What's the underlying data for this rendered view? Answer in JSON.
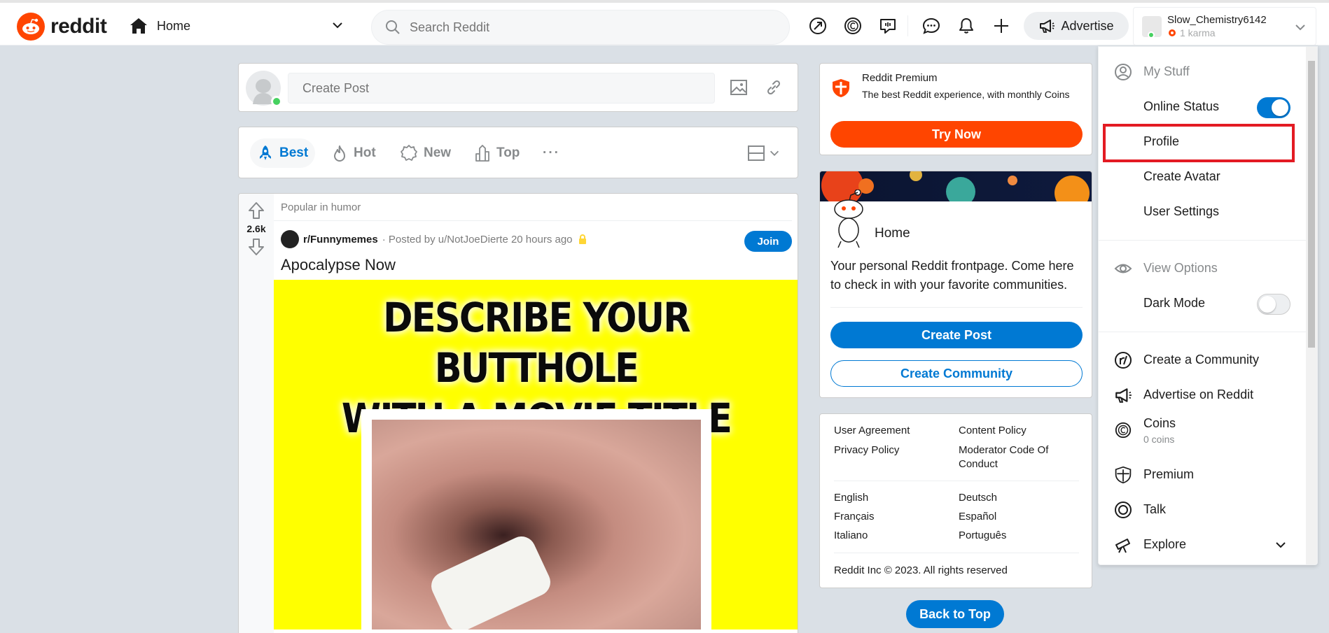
{
  "header": {
    "logo_text": "reddit",
    "home_label": "Home",
    "search_placeholder": "Search Reddit",
    "advertise_label": "Advertise",
    "username": "Slow_Chemistry6142",
    "karma": "1 karma"
  },
  "create_post": {
    "placeholder": "Create Post"
  },
  "sort_bar": {
    "items": [
      {
        "label": "Best",
        "active": true
      },
      {
        "label": "Hot",
        "active": false
      },
      {
        "label": "New",
        "active": false
      },
      {
        "label": "Top",
        "active": false
      }
    ],
    "more": "···"
  },
  "post": {
    "popular_label": "Popular in humor",
    "votes": "2.6k",
    "subreddit": "r/Funnymemes",
    "posted_by": "· Posted by u/NotJoeDierte 20 hours ago",
    "join_label": "Join",
    "title": "Apocalypse Now",
    "meme_line1": "DESCRIBE YOUR BUTTHOLE",
    "meme_line2": "WITH A MOVIE TITLE"
  },
  "premium": {
    "title": "Reddit Premium",
    "description": "The best Reddit experience, with monthly Coins",
    "button": "Try Now"
  },
  "home_card": {
    "title": "Home",
    "description": "Your personal Reddit frontpage. Come here to check in with your favorite communities.",
    "create_post": "Create Post",
    "create_community": "Create Community"
  },
  "footer": {
    "links_col1": [
      "User Agreement",
      "Privacy Policy"
    ],
    "links_col2a": "Content Policy",
    "links_col2b": "Moderator Code Of Conduct",
    "languages_col1": [
      "English",
      "Français",
      "Italiano"
    ],
    "languages_col2": [
      "Deutsch",
      "Español",
      "Português"
    ],
    "copyright": "Reddit Inc © 2023. All rights reserved",
    "back_to_top": "Back to Top"
  },
  "dropdown": {
    "my_stuff": "My Stuff",
    "online_status": "Online Status",
    "online_status_on": true,
    "profile": "Profile",
    "create_avatar": "Create Avatar",
    "user_settings": "User Settings",
    "view_options": "View Options",
    "dark_mode": "Dark Mode",
    "dark_mode_on": false,
    "create_community": "Create a Community",
    "advertise": "Advertise on Reddit",
    "coins": "Coins",
    "coins_sub": "0 coins",
    "premium": "Premium",
    "talk": "Talk",
    "explore": "Explore"
  },
  "colors": {
    "brand": "#ff4500",
    "accent": "#0079d3",
    "highlight": "#e31b23"
  }
}
